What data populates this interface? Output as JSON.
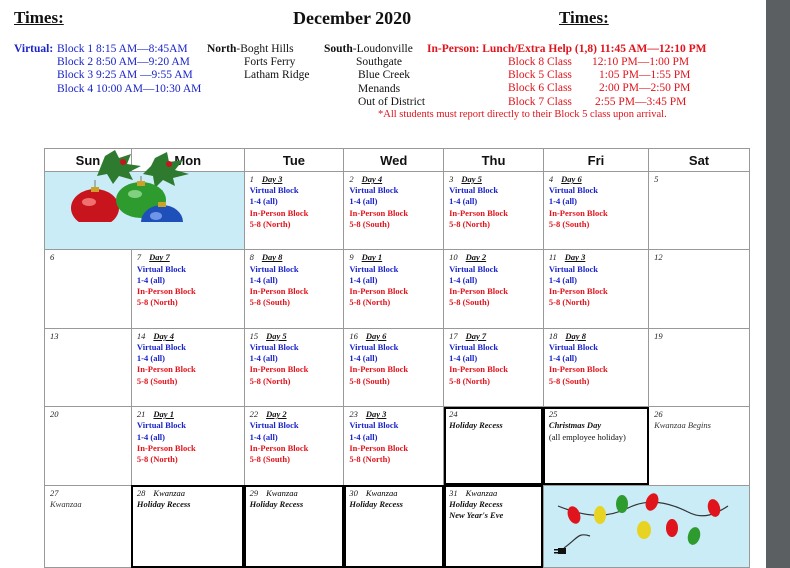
{
  "header": {
    "times_left": "Times:",
    "title": "December 2020",
    "times_right": "Times:"
  },
  "virtual": {
    "label": "Virtual:",
    "blocks": [
      "Block 1 8:15 AM—8:45AM",
      "Block 2 8:50 AM—9:20 AM",
      "Block 3 9:25 AM —9:55 AM",
      "Block 4 10:00 AM—10:30 AM"
    ]
  },
  "north": {
    "label": "North",
    "items": [
      "-Boght Hills",
      "Forts Ferry",
      "Latham Ridge"
    ]
  },
  "south": {
    "label": "South",
    "items": [
      "-Loudonville",
      "Southgate",
      "Blue Creek",
      "Menands",
      "Out of District"
    ]
  },
  "in_person": {
    "heading": "In-Person: Lunch/Extra Help (1,8) 11:45 AM—12:10 PM",
    "rows": [
      {
        "block": "Block 8 Class",
        "time": "12:10 PM—1:00 PM"
      },
      {
        "block": "Block 5 Class",
        "time": "1:05 PM—1:55 PM"
      },
      {
        "block": "Block 6 Class",
        "time": "2:00 PM—2:50 PM"
      },
      {
        "block": "Block 7 Class",
        "time": "2:55 PM—3:45 PM"
      }
    ],
    "note": "*All students must report directly to their Block 5 class upon arrival."
  },
  "weekdays": [
    "Sun",
    "Mon",
    "Tue",
    "Wed",
    "Thu",
    "Fri",
    "Sat"
  ],
  "labels": {
    "virtual_block": "Virtual Block",
    "all": "1-4 (all)",
    "in_person_block": "In-Person Block",
    "north": "5-8 (North)",
    "south": "5-8 (South)"
  },
  "days": {
    "d1": {
      "num": "1",
      "day": "Day 3"
    },
    "d2": {
      "num": "2",
      "day": "Day 4"
    },
    "d3": {
      "num": "3",
      "day": "Day 5"
    },
    "d4": {
      "num": "4",
      "day": "Day 6"
    },
    "d5": {
      "num": "5"
    },
    "d6": {
      "num": "6"
    },
    "d7": {
      "num": "7",
      "day": "Day 7"
    },
    "d8": {
      "num": "8",
      "day": "Day 8"
    },
    "d9": {
      "num": "9",
      "day": "Day 1"
    },
    "d10": {
      "num": "10",
      "day": "Day 2"
    },
    "d11": {
      "num": "11",
      "day": "Day 3"
    },
    "d12": {
      "num": "12"
    },
    "d13": {
      "num": "13"
    },
    "d14": {
      "num": "14",
      "day": "Day 4"
    },
    "d15": {
      "num": "15",
      "day": "Day 5"
    },
    "d16": {
      "num": "16",
      "day": "Day 6"
    },
    "d17": {
      "num": "17",
      "day": "Day 7"
    },
    "d18": {
      "num": "18",
      "day": "Day 8"
    },
    "d19": {
      "num": "19"
    },
    "d20": {
      "num": "20"
    },
    "d21": {
      "num": "21",
      "day": "Day 1"
    },
    "d22": {
      "num": "22",
      "day": "Day 2"
    },
    "d23": {
      "num": "23",
      "day": "Day 3"
    },
    "d24": {
      "num": "24",
      "note": "Holiday Recess"
    },
    "d25": {
      "num": "25",
      "note": "Christmas Day",
      "sub": "(all employee holiday)"
    },
    "d26": {
      "num": "26",
      "note": "Kwanzaa Begins"
    },
    "d27": {
      "num": "27",
      "note": "Kwanzaa"
    },
    "d28": {
      "num": "28",
      "kw": "Kwanzaa",
      "note": "Holiday Recess"
    },
    "d29": {
      "num": "29",
      "kw": "Kwanzaa",
      "note": "Holiday Recess"
    },
    "d30": {
      "num": "30",
      "kw": "Kwanzaa",
      "note": "Holiday Recess"
    },
    "d31": {
      "num": "31",
      "kw": "Kwanzaa",
      "note": "Holiday Recess",
      "note2": "New Year's Eve"
    }
  },
  "decorations": {
    "ornaments_icon": "christmas-ornaments-icon",
    "lights_icon": "christmas-lights-icon",
    "colors": {
      "red": "#c8141c",
      "green": "#2e9b2e",
      "blue": "#1f4fb8",
      "sky": "#c9ecf7"
    }
  }
}
